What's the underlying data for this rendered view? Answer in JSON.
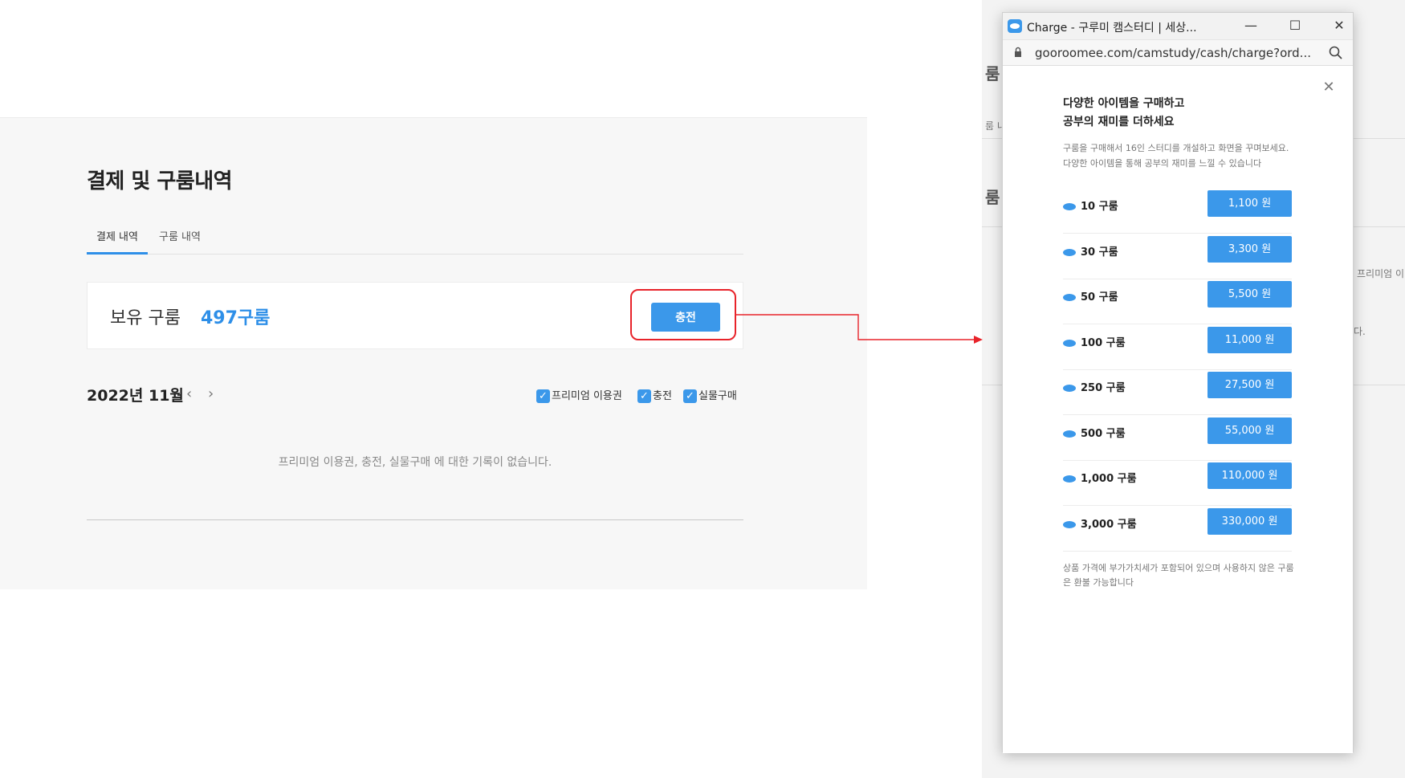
{
  "page": {
    "title": "결제 및 구룸내역",
    "tabs": [
      {
        "label": "결제 내역",
        "active": true
      },
      {
        "label": "구룸 내역",
        "active": false
      }
    ],
    "balance": {
      "label": "보유 구룸",
      "value": "497구룸"
    },
    "charge_button": "충전",
    "month": "2022년 11월",
    "filters": [
      {
        "label": "프리미엄 이용권",
        "checked": true
      },
      {
        "label": "충전",
        "checked": true
      },
      {
        "label": "실물구매",
        "checked": true
      }
    ],
    "empty_message": "프리미엄 이용권, 충전, 실물구매 에 대한 기록이 없습니다."
  },
  "background_page": {
    "fragments": [
      "룸",
      "룸 내",
      "룸",
      "프리미엄 이",
      "다."
    ]
  },
  "popup": {
    "window_title": "Charge - 구루미 캠스터디 | 세상...",
    "url": "gooroomee.com/camstudy/cash/charge?ord...",
    "headline_line1": "다양한 아이템을 구매하고",
    "headline_line2": "공부의 재미를 더하세요",
    "description": "구룸을 구매해서 16인 스터디를 개설하고 화면을 꾸며보세요. 다양한 아이템을 통해 공부의 재미를 느낄 수 있습니다",
    "items": [
      {
        "label": "10 구룸",
        "price": "1,100 원"
      },
      {
        "label": "30 구룸",
        "price": "3,300 원"
      },
      {
        "label": "50 구룸",
        "price": "5,500 원"
      },
      {
        "label": "100 구룸",
        "price": "11,000 원"
      },
      {
        "label": "250 구룸",
        "price": "27,500 원"
      },
      {
        "label": "500 구룸",
        "price": "55,000 원"
      },
      {
        "label": "1,000 구룸",
        "price": "110,000 원"
      },
      {
        "label": "3,000 구룸",
        "price": "330,000 원"
      }
    ],
    "notice": "상품 가격에 부가가치세가 포함되어 있으며 사용하지 않은 구룸은 환불 가능합니다"
  },
  "colors": {
    "accent": "#3b98ea",
    "highlight": "#e8232a"
  }
}
